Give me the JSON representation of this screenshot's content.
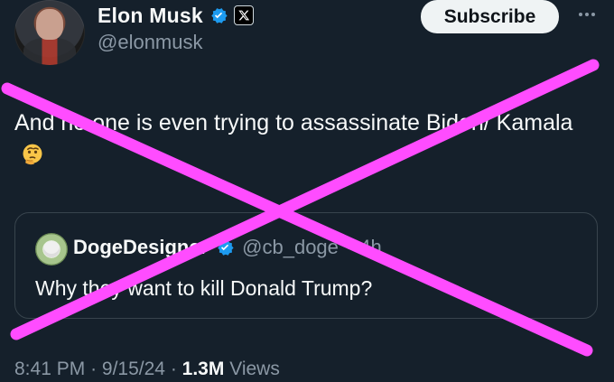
{
  "author": {
    "display_name": "Elon Musk",
    "handle": "@elonmusk",
    "verified": true,
    "badge_label": "𝕏"
  },
  "subscribe_label": "Subscribe",
  "tweet": {
    "text": "And no one is even trying to assassinate Biden/ Kamala",
    "emoji": "thinking-face"
  },
  "quote": {
    "display_name": "DogeDesigner",
    "handle": "@cb_doge",
    "separator": "·",
    "time": "4h",
    "text": "Why they want to kill Donald Trump?"
  },
  "meta": {
    "time": "8:41 PM",
    "date": "9/15/24",
    "separator": "·",
    "views_count": "1.3M",
    "views_label": "Views"
  },
  "colors": {
    "background": "#15202b",
    "primary_text": "#f7f9f9",
    "secondary_text": "#8b98a5",
    "verified": "#1d9bf0",
    "overlay_x": "#ff4cff"
  }
}
